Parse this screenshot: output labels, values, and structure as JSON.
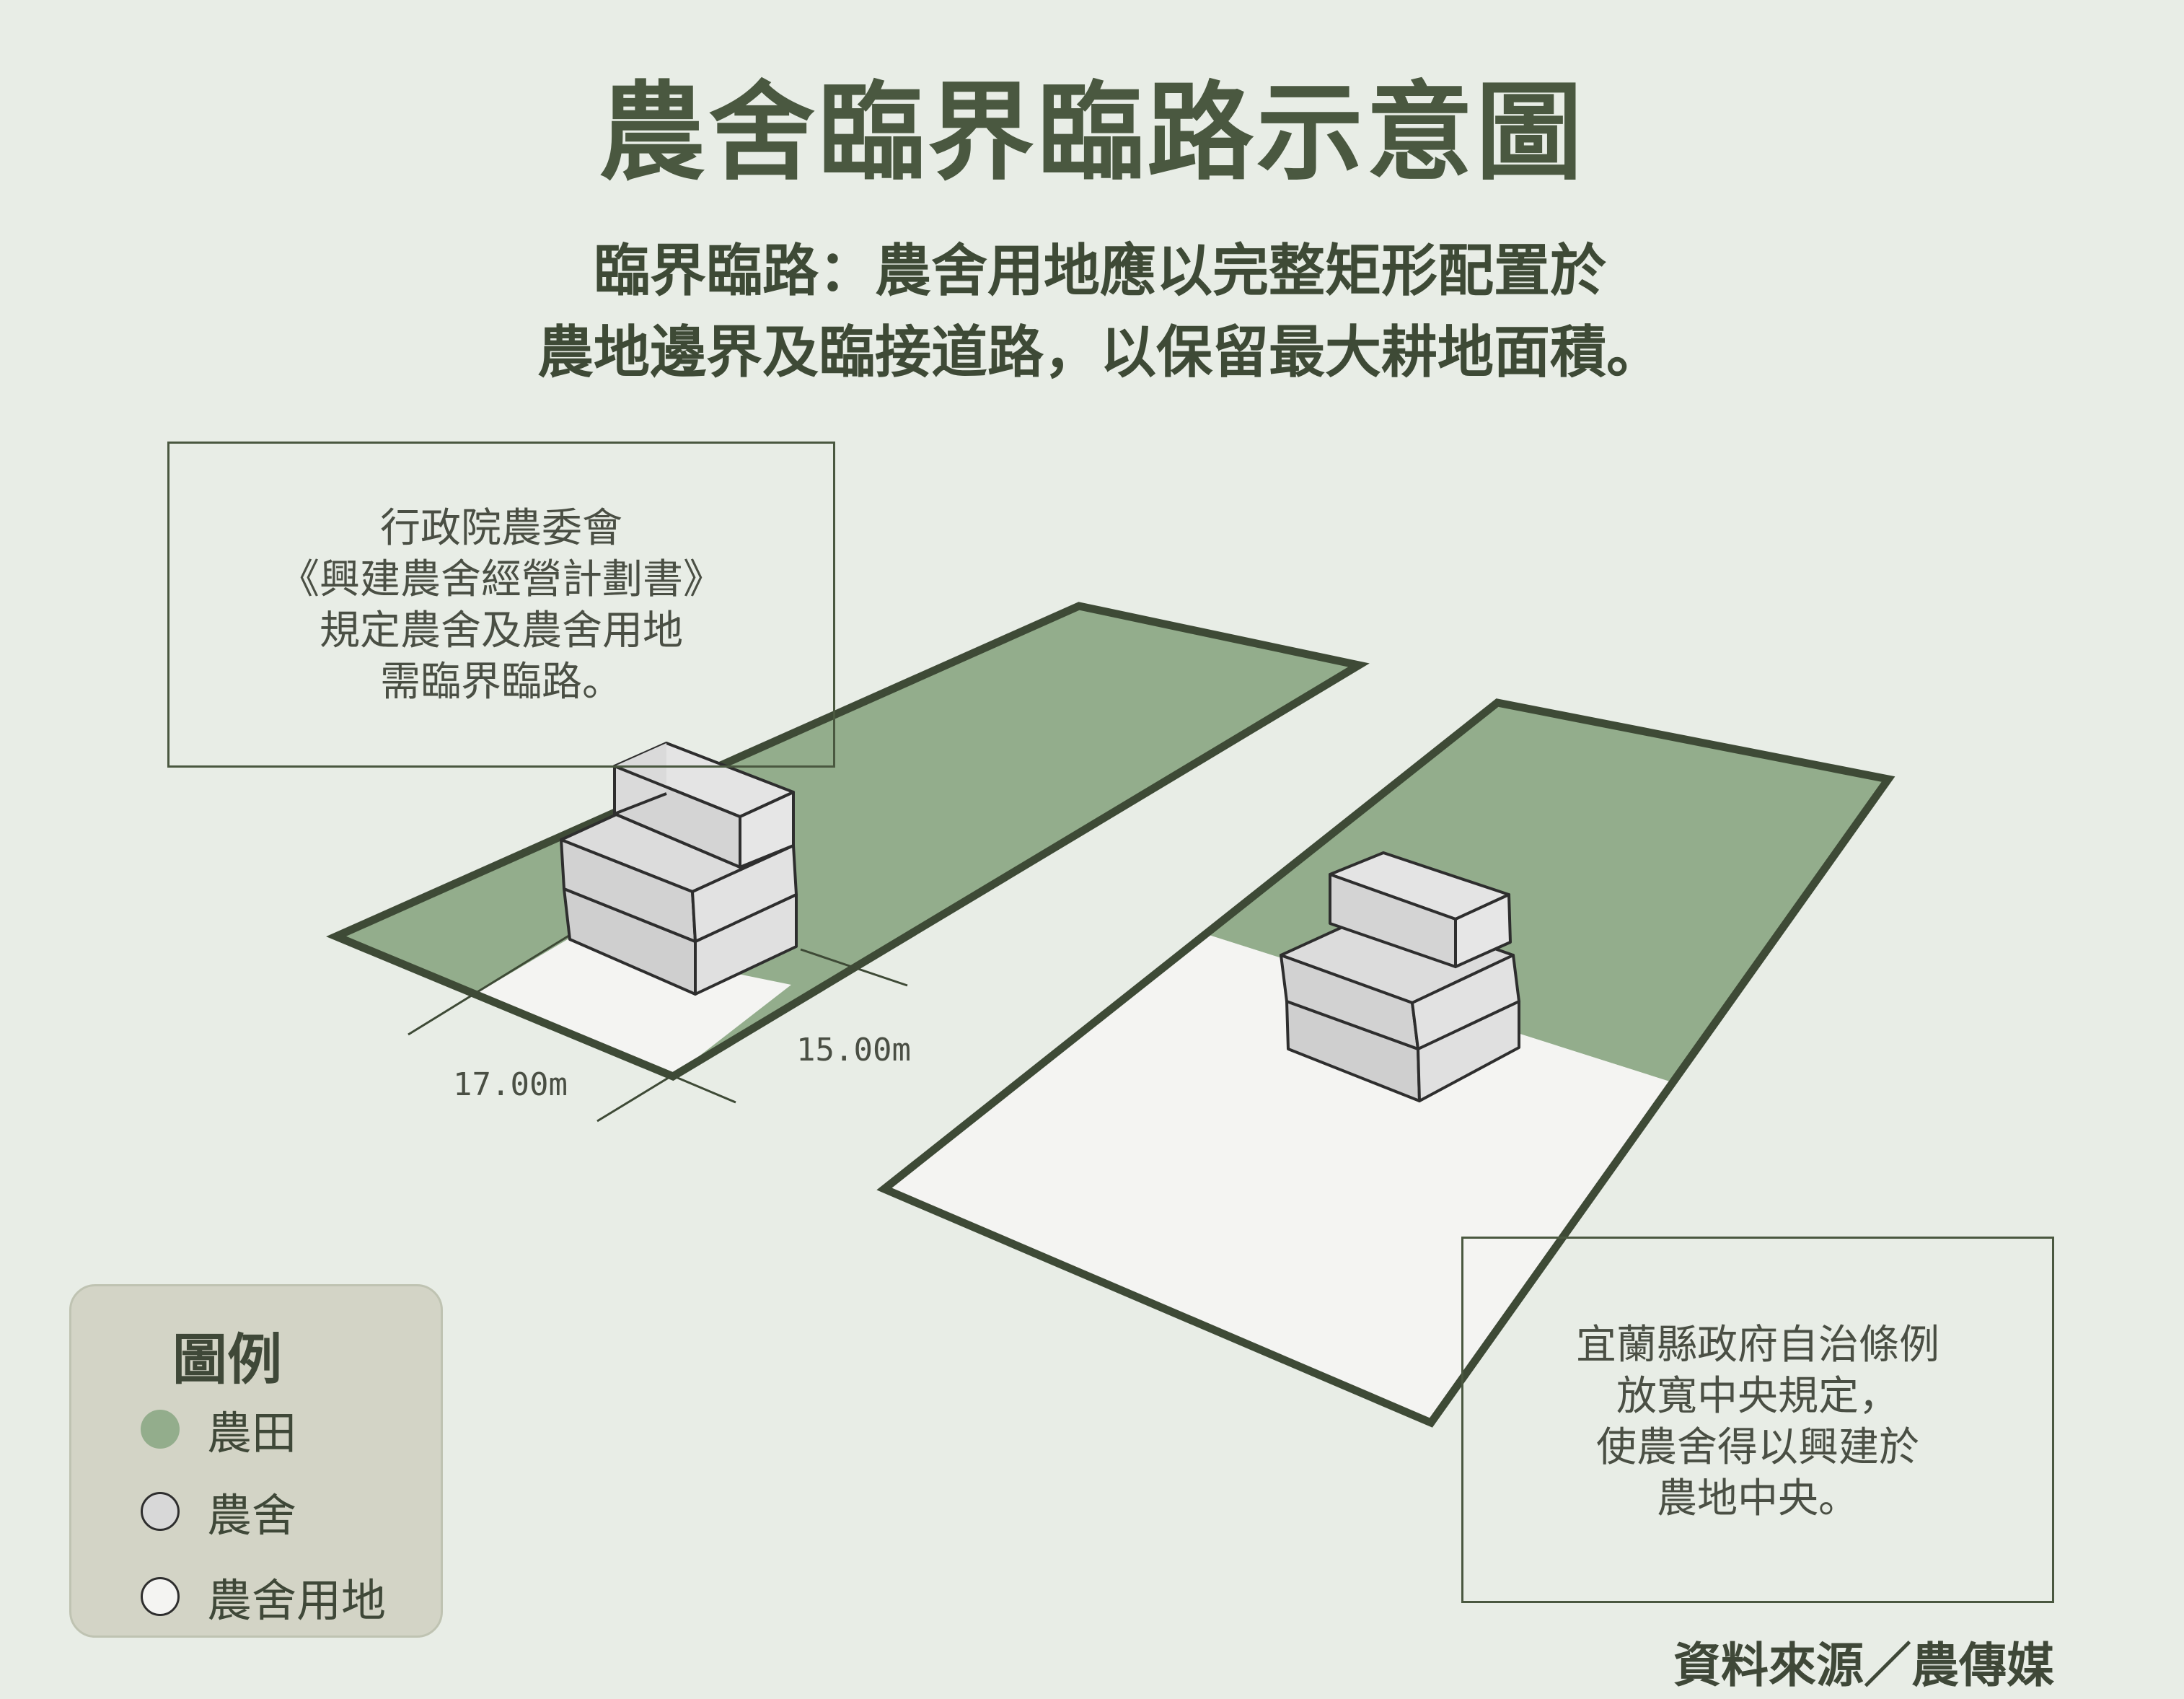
{
  "title": "農舍臨界臨路示意圖",
  "subtitle": {
    "line1": "臨界臨路：農舍用地應以完整矩形配置於",
    "line2": "農地邊界及臨接道路，以保留最大耕地面積。"
  },
  "left_note": {
    "lines": [
      "行政院農委會",
      "《興建農舍經營計劃書》",
      "規定農舍及農舍用地",
      "需臨界臨路。"
    ]
  },
  "right_note": {
    "lines": [
      "宜蘭縣政府自治條例",
      "放寬中央規定，",
      "使農舍得以興建於",
      "農地中央。"
    ]
  },
  "dimensions": {
    "width_label": "17.00m",
    "depth_label": "15.00m"
  },
  "legend": {
    "title": "圖例",
    "items": [
      {
        "label": "農田",
        "color": "#93ad8c"
      },
      {
        "label": "農舍",
        "color": "#d8d8d8"
      },
      {
        "label": "農舍用地",
        "color": "#f4f4f2"
      }
    ]
  },
  "source": "資料來源／農傳媒",
  "colors": {
    "background": "#e8ede6",
    "farmland": "#93ad8c",
    "house": "#d8d8d8",
    "house_site": "#f4f4f2",
    "border": "#3e4a36"
  }
}
